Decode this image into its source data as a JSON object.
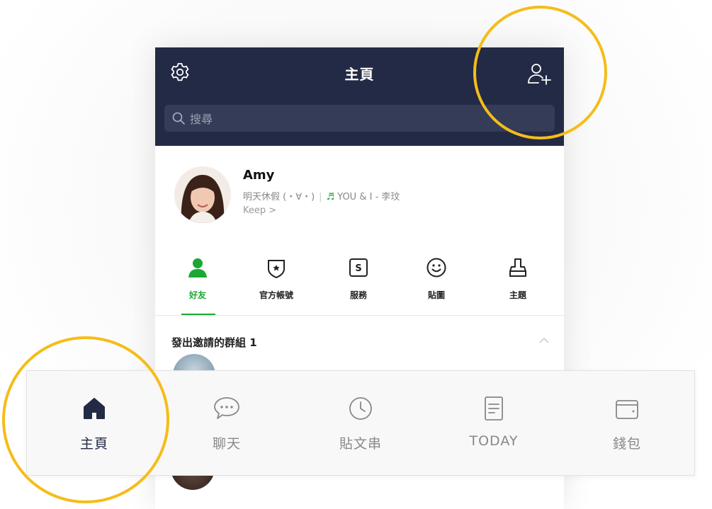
{
  "header": {
    "title": "主頁",
    "search_placeholder": "搜尋"
  },
  "profile": {
    "name": "Amy",
    "status": "明天休假 (・∀・)",
    "music_title": "YOU & I - 李玟",
    "keep_label": "Keep >"
  },
  "tabs": [
    {
      "label": "好友",
      "icon": "friend-icon",
      "active": true
    },
    {
      "label": "官方帳號",
      "icon": "official-account-icon"
    },
    {
      "label": "服務",
      "icon": "service-icon"
    },
    {
      "label": "貼圖",
      "icon": "sticker-icon"
    },
    {
      "label": "主題",
      "icon": "theme-icon"
    }
  ],
  "groups": {
    "invited_title": "發出邀請的群組 1"
  },
  "bottom_nav": [
    {
      "label": "主頁",
      "icon": "home-icon",
      "active": true
    },
    {
      "label": "聊天",
      "icon": "chat-icon"
    },
    {
      "label": "貼文串",
      "icon": "timeline-icon"
    },
    {
      "label": "TODAY",
      "icon": "today-icon"
    },
    {
      "label": "錢包",
      "icon": "wallet-icon"
    }
  ],
  "colors": {
    "header_bg": "#232a45",
    "accent_green": "#1aa832",
    "highlight_ring": "#f5bd1a"
  }
}
